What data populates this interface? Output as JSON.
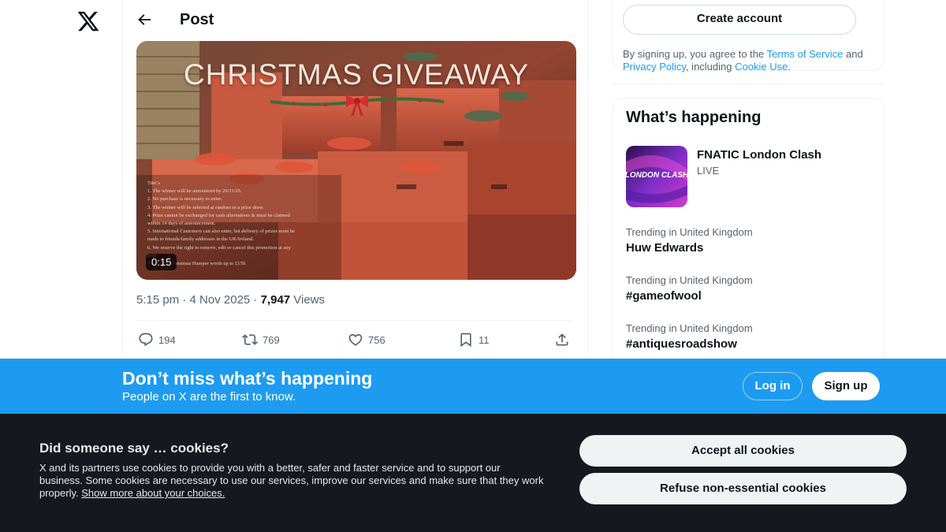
{
  "post_header": {
    "title": "Post"
  },
  "media": {
    "overlay_title": "CHRISTMAS GIVEAWAY",
    "tcs_lines": [
      "T&Cs",
      "1. The winner will be announced by 26/11/25.",
      "2. No purchase is necessary to enter.",
      "3. The winner will be selected at random in a prize draw.",
      "4. Prize cannot be exchanged for cash alternatives & must be claimed",
      "within 14 days of announcement.",
      "5. International Customers can also enter, but delivery of prizes must be",
      "made to friends/family addresses in the UK/Ireland.",
      "6. We reserve the right to remove, edit or cancel this promotion at any",
      "time.",
      "7. ...ll be a Christmas Hamper worth up to £150."
    ],
    "duration": "0:15"
  },
  "meta": {
    "time_date": "5:15 pm · 4 Nov 2025 · ",
    "views_count": "7,947",
    "views_label": " Views"
  },
  "actions": {
    "replies": "194",
    "reposts": "769",
    "likes": "756",
    "bookmarks": "11"
  },
  "sidebar": {
    "create_account": "Create account",
    "terms_prefix": "By signing up, you agree to the ",
    "terms_link": "Terms of Service",
    "terms_and": " and ",
    "privacy_link": "Privacy Policy",
    "including": ", including ",
    "cookie_link": "Cookie Use",
    "period": ".",
    "happening_title": "What’s happening",
    "event": {
      "name": "FNATIC London Clash",
      "status": "LIVE",
      "thumb_text": "LONDON CLASH"
    },
    "trends": [
      {
        "context": "Trending in United Kingdom",
        "name": "Huw Edwards"
      },
      {
        "context": "Trending in United Kingdom",
        "name": "#gameofwool"
      },
      {
        "context": "Trending in United Kingdom",
        "name": "#antiquesroadshow"
      }
    ]
  },
  "bluebar": {
    "title": "Don’t miss what’s happening",
    "subtitle": "People on X are the first to know.",
    "login": "Log in",
    "signup": "Sign up"
  },
  "cookie": {
    "title": "Did someone say … cookies?",
    "body": "X and its partners use cookies to provide you with a better, safer and faster service and to support our business. Some cookies are necessary to use our services, improve our services and make sure that they work properly. ",
    "link": "Show more about your choices.",
    "accept": "Accept all cookies",
    "refuse": "Refuse non-essential cookies"
  },
  "colors": {
    "accent": "#1d9bf0",
    "text": "#0f1419",
    "muted": "#536471",
    "cookie_bg": "#15181c"
  }
}
